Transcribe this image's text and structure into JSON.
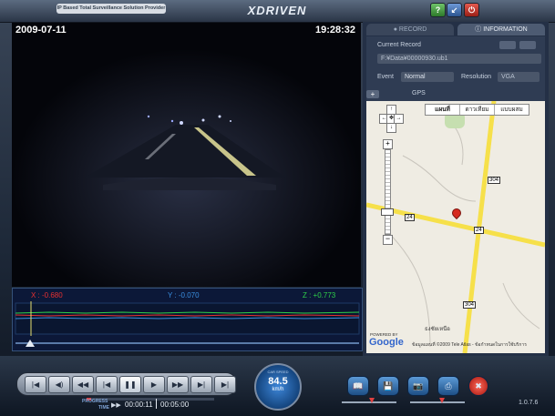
{
  "header": {
    "tagline": "IP Based Total Surveillance Solution Provider",
    "logo": "XDRIVEN"
  },
  "video": {
    "date": "2009-07-11",
    "time": "19:28:32"
  },
  "sensor": {
    "x_label": "X : -0.680",
    "y_label": "Y : -0.070",
    "z_label": "Z : +0.773",
    "colors": {
      "x": "#e83030",
      "y": "#3a8fe0",
      "z": "#2fd04a"
    }
  },
  "tabs": {
    "record": "RECORD",
    "information": "INFORMATION"
  },
  "record_info": {
    "current_record_label": "Current Record",
    "file_path": "F:¥Data¥00000930.ub1",
    "event_label": "Event",
    "event_value": "Normal",
    "resolution_label": "Resolution",
    "resolution_value": "VGA"
  },
  "gps": {
    "label": "GPS",
    "plus": "+",
    "map_types": [
      "แผนที่",
      "ดาวเทียม",
      "แบบผสม"
    ],
    "road_labels": [
      "304",
      "24",
      "24",
      "304"
    ],
    "place_label": "ธงชัยเหนือ",
    "powered_by": "POWERED BY",
    "google": "Google",
    "copyright": "ข้อมูลแผนที่ ©2009 Tele Atlas - ข้อกำหนดในการใช้บริการ"
  },
  "playback": {
    "progress_label": "PROGRESS",
    "time_label": "TIME",
    "elapsed": "00:00:11",
    "total": "00:05:00",
    "speed_caption": "CAR SPEED",
    "speed_value": "84.5",
    "speed_unit": "km/h",
    "version": "1.0.7.6",
    "progress_fraction": 0.037
  }
}
